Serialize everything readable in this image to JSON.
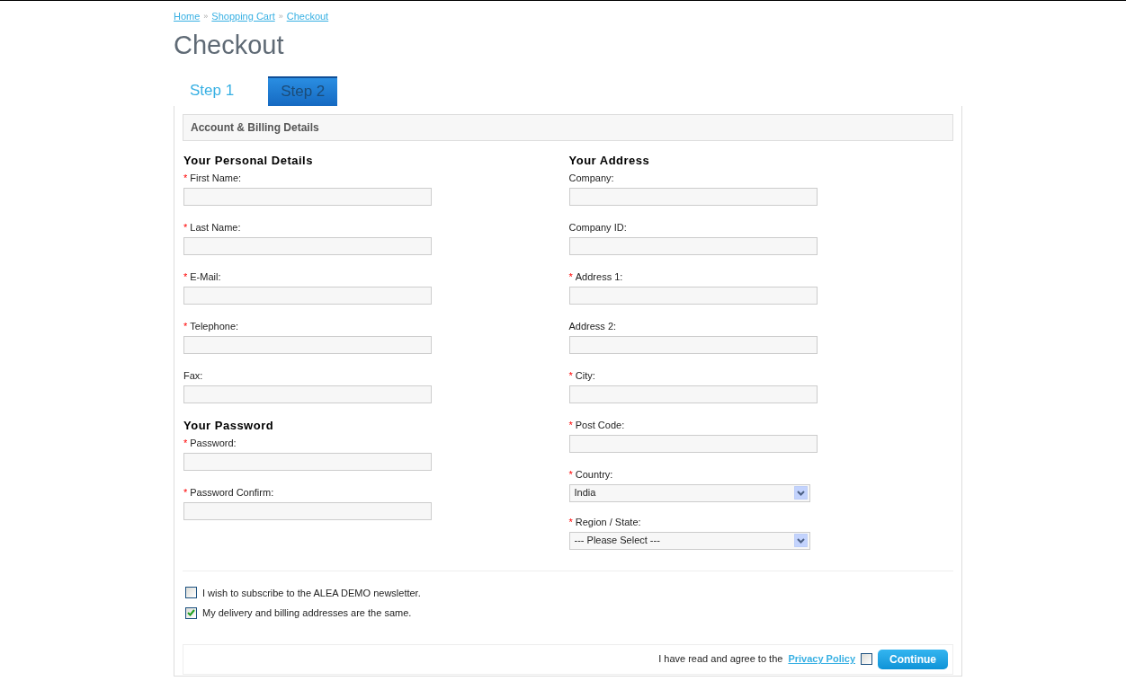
{
  "breadcrumb": [
    {
      "label": "Home"
    },
    {
      "label": "Shopping Cart"
    },
    {
      "label": "Checkout"
    }
  ],
  "breadcrumb_separator": "»",
  "title": "Checkout",
  "tabs": [
    {
      "label": "Step 1",
      "selected": false
    },
    {
      "label": "Step 2",
      "selected": true
    }
  ],
  "section_title": "Account & Billing Details",
  "columns": [
    {
      "sections": [
        {
          "heading": "Your Personal Details",
          "fields": [
            {
              "label": "First Name:",
              "required": true,
              "kind": "text"
            },
            {
              "label": "Last Name:",
              "required": true,
              "kind": "text"
            },
            {
              "label": "E-Mail:",
              "required": true,
              "kind": "text"
            },
            {
              "label": "Telephone:",
              "required": true,
              "kind": "text"
            },
            {
              "label": "Fax:",
              "required": false,
              "kind": "text"
            }
          ]
        },
        {
          "heading": "Your Password",
          "fields": [
            {
              "label": "Password:",
              "required": true,
              "kind": "text"
            },
            {
              "label": "Password Confirm:",
              "required": true,
              "kind": "text"
            }
          ]
        }
      ]
    },
    {
      "sections": [
        {
          "heading": "Your Address",
          "fields": [
            {
              "label": "Company:",
              "required": false,
              "kind": "text"
            },
            {
              "label": "Company ID:",
              "required": false,
              "kind": "text"
            },
            {
              "label": "Address 1:",
              "required": true,
              "kind": "text"
            },
            {
              "label": "Address 2:",
              "required": false,
              "kind": "text"
            },
            {
              "label": "City:",
              "required": true,
              "kind": "text"
            },
            {
              "label": "Post Code:",
              "required": true,
              "kind": "text"
            },
            {
              "label": "Country:",
              "required": true,
              "kind": "select",
              "value": "India"
            },
            {
              "label": "Region / State:",
              "required": true,
              "kind": "select",
              "value": "--- Please Select ---"
            }
          ]
        }
      ]
    }
  ],
  "required_mark": "*",
  "options": [
    {
      "label": "I wish to subscribe to the ALEA DEMO newsletter.",
      "checked": false
    },
    {
      "label": "My delivery and billing addresses are the same.",
      "checked": true
    }
  ],
  "agreement": {
    "text": "I have read and agree to the",
    "link": "Privacy Policy",
    "checked": false
  },
  "continue_button": "Continue"
}
